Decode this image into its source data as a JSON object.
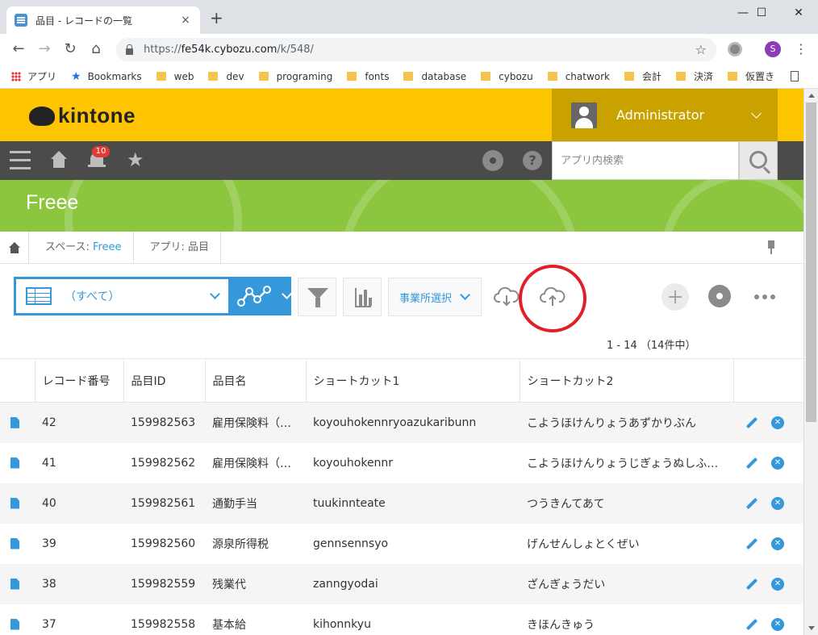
{
  "browser": {
    "tab_title": "品目 - レコードの一覧",
    "tab_close": "×",
    "new_tab": "+",
    "url_scheme": "https://",
    "url_host": "fe54k.cybozu.com",
    "url_path": "/k/548/",
    "profile_initial": "S",
    "window_controls": {
      "minimize": "—",
      "maximize": "☐",
      "close": "✕"
    },
    "bookmarks": [
      "アプリ",
      "Bookmarks",
      "web",
      "dev",
      "programing",
      "fonts",
      "database",
      "cybozu",
      "chatwork",
      "会計",
      "決済",
      "仮置き"
    ]
  },
  "header": {
    "logo": "kintone",
    "username": "Administrator"
  },
  "toolbar": {
    "notification_count": "10",
    "search_placeholder": "アプリ内検索"
  },
  "app": {
    "title": "Freee"
  },
  "breadcrumb": {
    "space_prefix": "スペース: ",
    "space_name": "Freee",
    "app_crumb": "アプリ: 品目"
  },
  "actions": {
    "view_label": "（すべて）",
    "office_select": "事業所選択",
    "record_count": "1 - 14 （14件中）"
  },
  "table": {
    "columns": [
      "レコード番号",
      "品目ID",
      "品目名",
      "ショートカット1",
      "ショートカット2"
    ],
    "rows": [
      [
        "42",
        "159982563",
        "雇用保険料（…",
        "koyouhokennryoazukaribunn",
        "こようほけんりょうあずかりぶん"
      ],
      [
        "41",
        "159982562",
        "雇用保険料（…",
        "koyouhokennr",
        "こようほけんりょうじぎょうぬしふ…"
      ],
      [
        "40",
        "159982561",
        "通勤手当",
        "tuukinnteate",
        "つうきんてあて"
      ],
      [
        "39",
        "159982560",
        "源泉所得税",
        "gennsennsyo",
        "げんせんしょとくぜい"
      ],
      [
        "38",
        "159982559",
        "残業代",
        "zanngyodai",
        "ざんぎょうだい"
      ],
      [
        "37",
        "159982558",
        "基本給",
        "kihonnkyu",
        "きほんきゅう"
      ]
    ]
  },
  "colors": {
    "brand_yellow": "#fdc500",
    "app_green": "#8cc63f",
    "accent_blue": "#3498db",
    "highlight_red": "#e21f26"
  }
}
